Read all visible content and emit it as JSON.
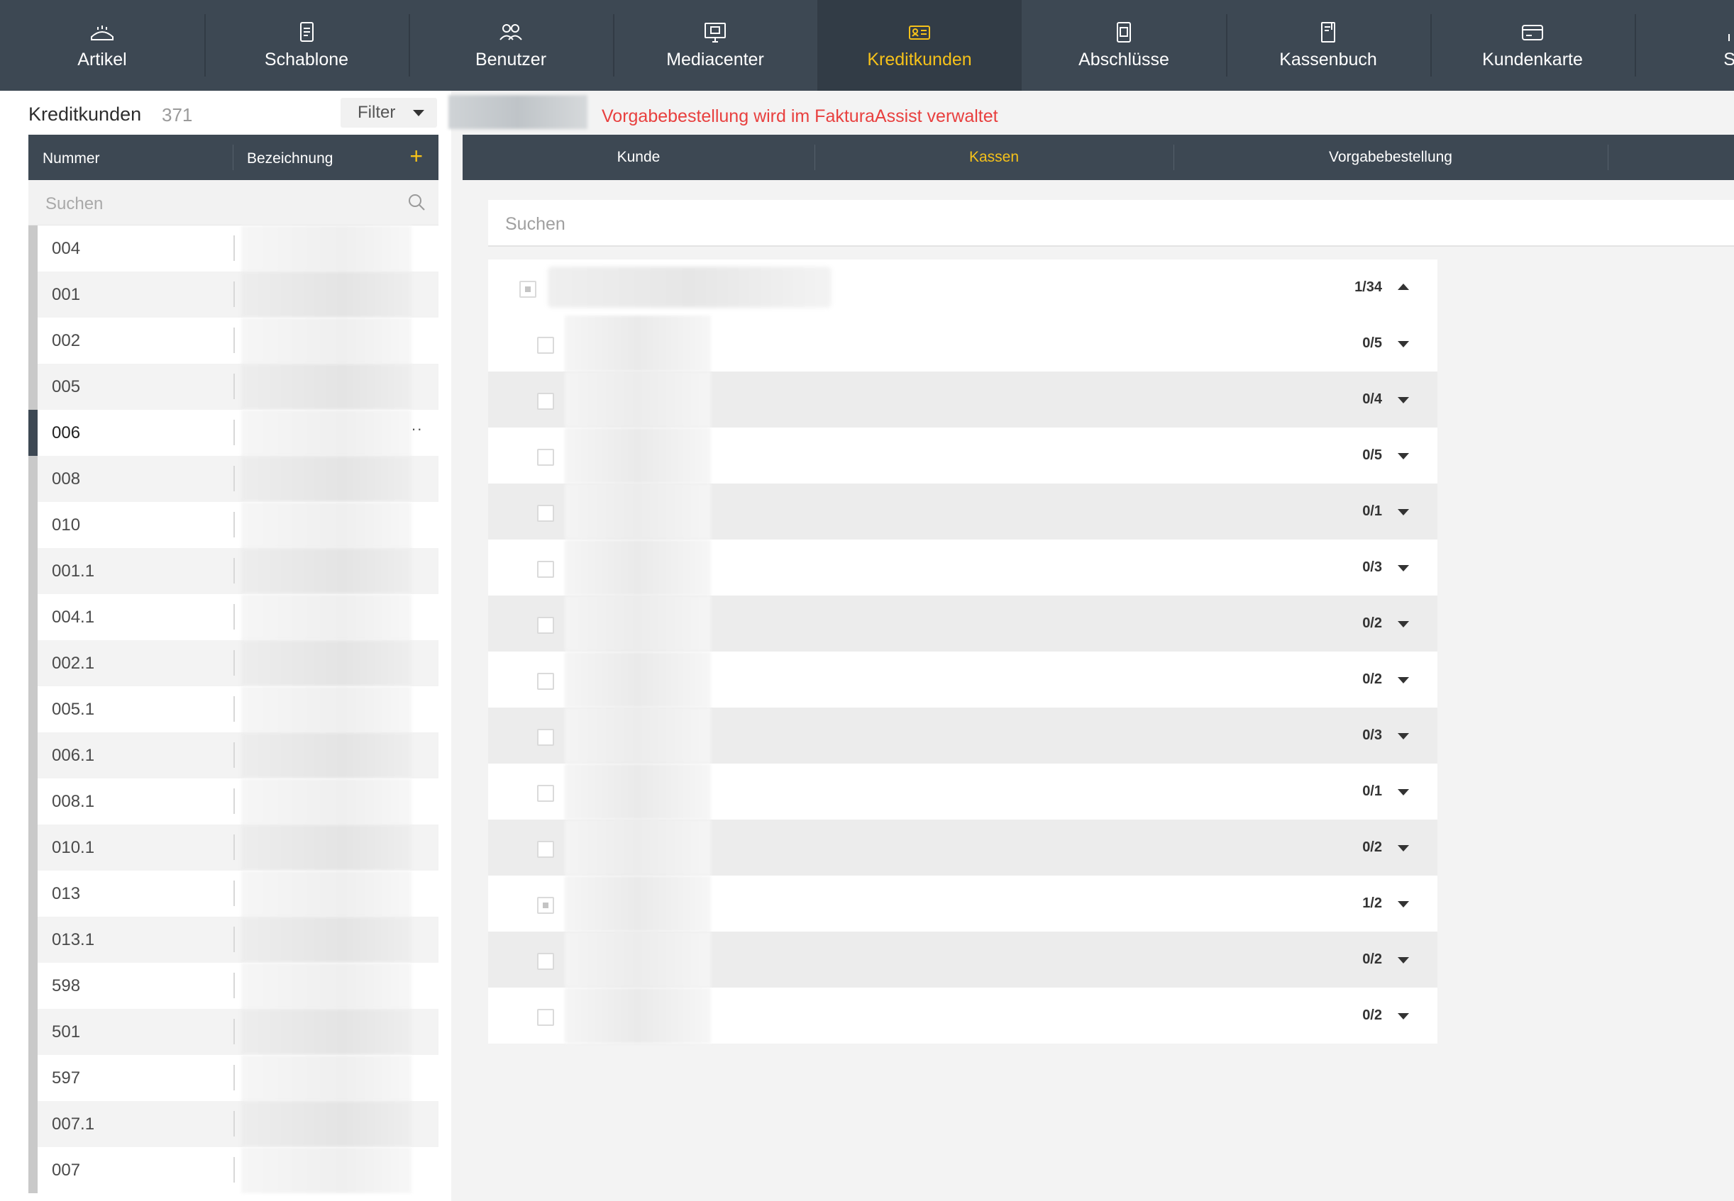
{
  "nav": {
    "items": [
      {
        "label": "Artikel",
        "icon": "bread-icon"
      },
      {
        "label": "Schablone",
        "icon": "template-icon"
      },
      {
        "label": "Benutzer",
        "icon": "users-icon"
      },
      {
        "label": "Mediacenter",
        "icon": "monitor-icon"
      },
      {
        "label": "Kreditkunden",
        "icon": "id-card-icon"
      },
      {
        "label": "Abschlüsse",
        "icon": "copy-icon"
      },
      {
        "label": "Kassenbuch",
        "icon": "book-icon"
      },
      {
        "label": "Kundenkarte",
        "icon": "card-icon"
      },
      {
        "label": "Sta",
        "icon": "stats-icon"
      }
    ],
    "active": "Kreditkunden",
    "accent_color": "#f5c11a",
    "bg_color": "#3d4853"
  },
  "left": {
    "title": "Kreditkunden",
    "count": "371",
    "filter_label": "Filter",
    "col_number": "Nummer",
    "col_name": "Bezeichnung",
    "add_symbol": "+",
    "search_placeholder": "Suchen",
    "rows": [
      "004",
      "001",
      "002",
      "005",
      "006",
      "008",
      "010",
      "001.1",
      "004.1",
      "002.1",
      "005.1",
      "006.1",
      "008.1",
      "010.1",
      "013",
      "013.1",
      "598",
      "501",
      "597",
      "007.1",
      "007"
    ],
    "active_row": "006",
    "more_symbol": "··"
  },
  "notice": {
    "text": "Vorgabebestellung wird im FakturaAssist verwaltet",
    "color": "#e8403f"
  },
  "tabs": {
    "items": [
      "Kunde",
      "Kassen",
      "Vorgabebestellung"
    ],
    "active": "Kassen"
  },
  "right": {
    "search_placeholder": "Suchen",
    "group": {
      "count": "1/34",
      "expanded": true,
      "partial": true
    },
    "children": [
      {
        "count": "0/5",
        "partial": false
      },
      {
        "count": "0/4",
        "partial": false
      },
      {
        "count": "0/5",
        "partial": false
      },
      {
        "count": "0/1",
        "partial": false
      },
      {
        "count": "0/3",
        "partial": false
      },
      {
        "count": "0/2",
        "partial": false
      },
      {
        "count": "0/2",
        "partial": false
      },
      {
        "count": "0/3",
        "partial": false
      },
      {
        "count": "0/1",
        "partial": false
      },
      {
        "count": "0/2",
        "partial": false
      },
      {
        "count": "1/2",
        "partial": true
      },
      {
        "count": "0/2",
        "partial": false
      },
      {
        "count": "0/2",
        "partial": false
      }
    ]
  }
}
